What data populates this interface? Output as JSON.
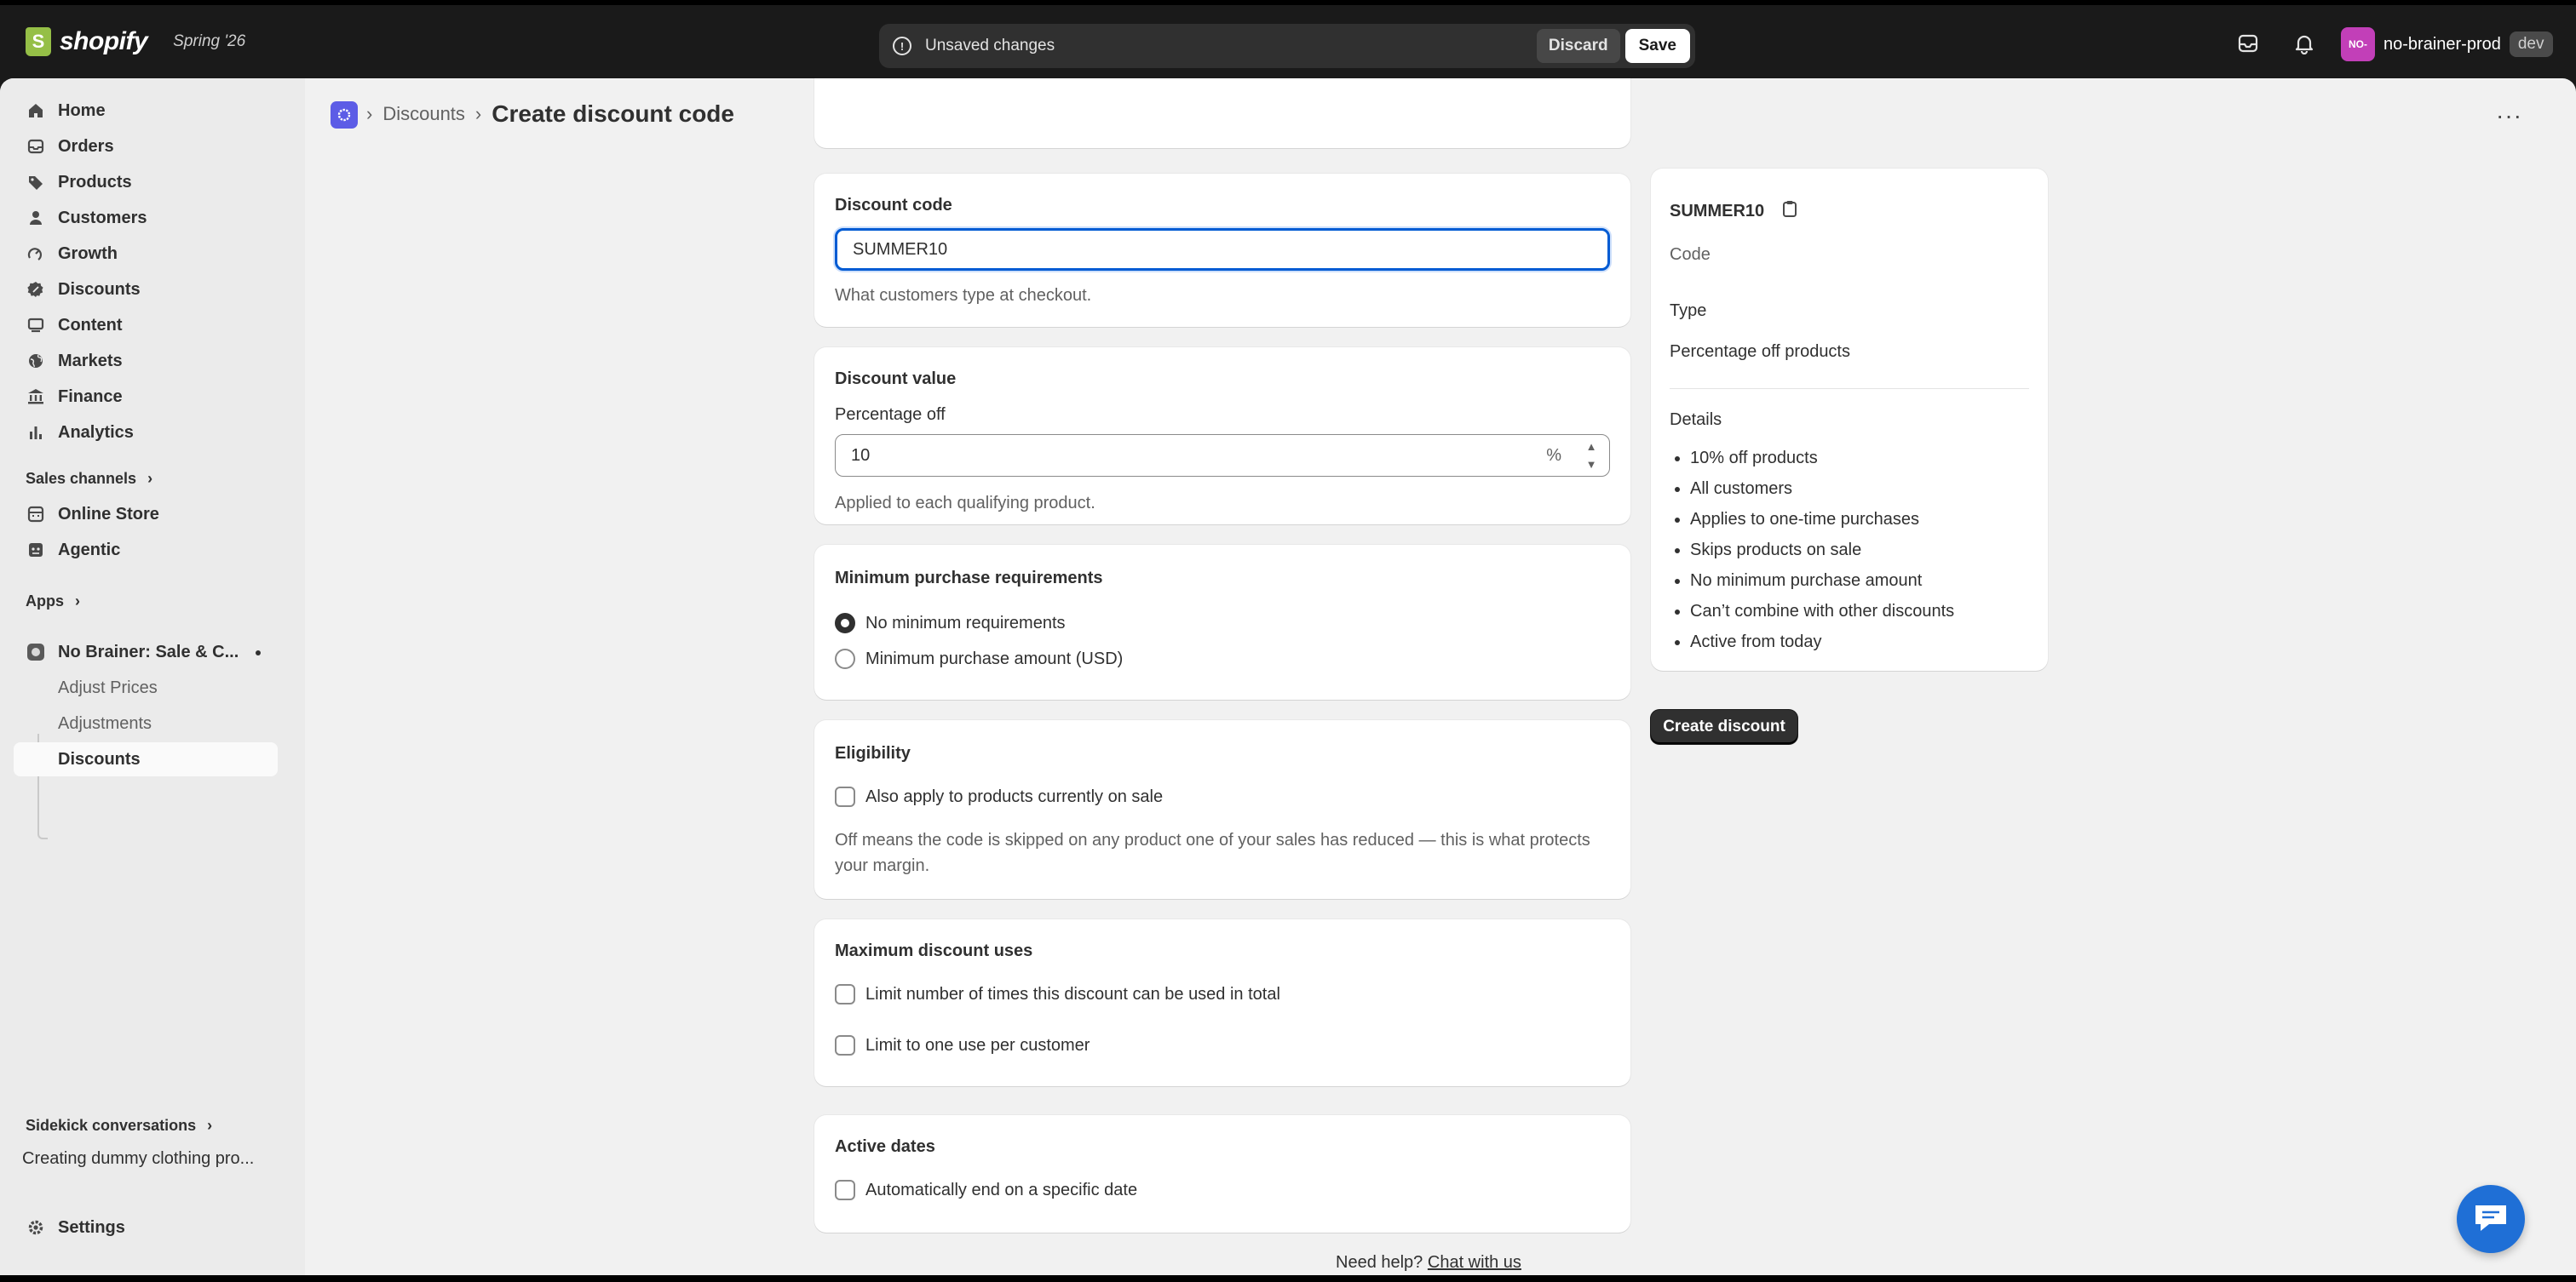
{
  "topbar": {
    "brand": "shopify",
    "brand_glyph": "S",
    "edition": "Spring '26",
    "unsaved_text": "Unsaved changes",
    "discard_label": "Discard",
    "save_label": "Save",
    "store_initials": "NO-",
    "store_name": "no-brainer-prod",
    "env_tag": "dev"
  },
  "sidebar": {
    "items": [
      {
        "label": "Home",
        "icon": "home-icon"
      },
      {
        "label": "Orders",
        "icon": "orders-icon"
      },
      {
        "label": "Products",
        "icon": "tag-icon"
      },
      {
        "label": "Customers",
        "icon": "person-icon"
      },
      {
        "label": "Growth",
        "icon": "growth-icon"
      },
      {
        "label": "Discounts",
        "icon": "discount-icon"
      },
      {
        "label": "Content",
        "icon": "content-icon"
      },
      {
        "label": "Markets",
        "icon": "globe-icon"
      },
      {
        "label": "Finance",
        "icon": "bank-icon"
      },
      {
        "label": "Analytics",
        "icon": "chart-icon"
      }
    ],
    "sales_channels_label": "Sales channels",
    "channels": [
      {
        "label": "Online Store",
        "icon": "store-icon"
      },
      {
        "label": "Agentic",
        "icon": "agent-icon"
      }
    ],
    "apps_label": "Apps",
    "app_name": "No Brainer: Sale & C...",
    "app_subitems": [
      "Adjust Prices",
      "Adjustments",
      "Discounts"
    ],
    "sidekick_label": "Sidekick conversations",
    "sidekick_item": "Creating dummy clothing pro...",
    "settings_label": "Settings"
  },
  "header": {
    "breadcrumb_parent": "Discounts",
    "separator": "›",
    "title": "Create discount code"
  },
  "discount_code": {
    "title": "Discount code",
    "value": "SUMMER10",
    "help": "What customers type at checkout."
  },
  "discount_value": {
    "title": "Discount value",
    "field_label": "Percentage off",
    "value": "10",
    "suffix": "%",
    "help": "Applied to each qualifying product."
  },
  "minimum_requirements": {
    "title": "Minimum purchase requirements",
    "options": [
      {
        "label": "No minimum requirements",
        "selected": true
      },
      {
        "label": "Minimum purchase amount (USD)",
        "selected": false
      }
    ]
  },
  "eligibility": {
    "title": "Eligibility",
    "checkbox_label": "Also apply to products currently on sale",
    "help": "Off means the code is skipped on any product one of your sales has reduced — this is what protects your margin."
  },
  "max_uses": {
    "title": "Maximum discount uses",
    "options": [
      "Limit number of times this discount can be used in total",
      "Limit to one use per customer"
    ]
  },
  "active_dates": {
    "title": "Active dates",
    "checkbox_label": "Automatically end on a specific date"
  },
  "summary": {
    "code": "SUMMER10",
    "code_label": "Code",
    "type_heading": "Type",
    "type_value": "Percentage off products",
    "details_heading": "Details",
    "details": [
      "10% off products",
      "All customers",
      "Applies to one-time purchases",
      "Skips products on sale",
      "No minimum purchase amount",
      "Can’t combine with other discounts",
      "Active from today"
    ]
  },
  "create_button": "Create discount",
  "footer": {
    "need_help": "Need help?",
    "chat_link": "Chat with us"
  },
  "colors": {
    "accent_focus": "#005bd3",
    "store_avatar": "#c23fb8",
    "chat_fab": "#1f6fd6"
  }
}
